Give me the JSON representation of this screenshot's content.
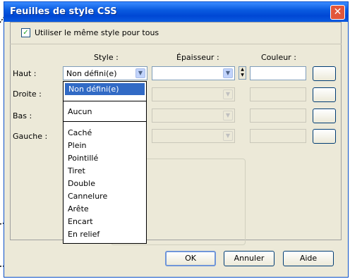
{
  "window": {
    "title": "Feuilles de style CSS",
    "close_symbol": "✕"
  },
  "checkbox": {
    "label": "Utiliser le même style pour tous",
    "checked": true
  },
  "columns": {
    "style": "Style :",
    "epaisseur": "Épaisseur :",
    "couleur": "Couleur :"
  },
  "rows": [
    {
      "label": "Haut :",
      "style_value": "Non défini(e)"
    },
    {
      "label": "Droite :"
    },
    {
      "label": "Bas :"
    },
    {
      "label": "Gauche :"
    }
  ],
  "dropdown": {
    "selected": "Non défini(e)",
    "items": [
      "Aucun",
      "Caché",
      "Plein",
      "Pointillé",
      "Tiret",
      "Double",
      "Cannelure",
      "Arête",
      "Encart",
      "En relief"
    ]
  },
  "buttons": {
    "ok": "OK",
    "cancel": "Annuler",
    "help": "Aide"
  },
  "colors": {
    "title_bar": "#0a5be0",
    "selection": "#316ac5",
    "dialog_bg": "#ece9d8"
  }
}
